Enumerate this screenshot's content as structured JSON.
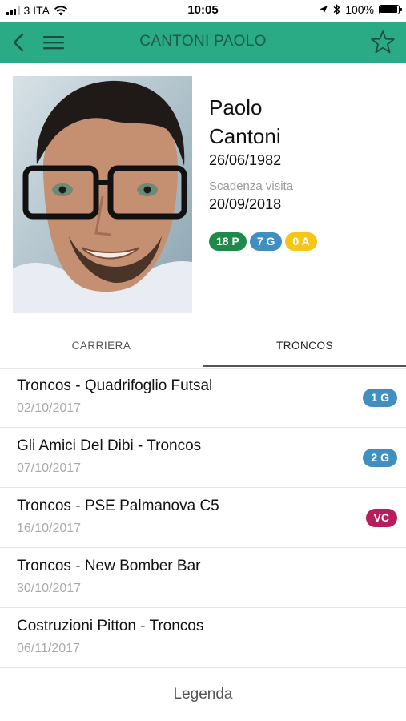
{
  "status_bar": {
    "carrier": "3 ITA",
    "time": "10:05",
    "battery": "100%",
    "battery_level": 1.0,
    "icons": [
      "signal-icon",
      "wifi-icon",
      "location-icon",
      "bluetooth-icon",
      "battery-icon"
    ]
  },
  "app_bar": {
    "title": "CANTONI PAOLO",
    "background_color": "#2aab86",
    "icons": [
      "back-icon",
      "menu-icon",
      "star-icon"
    ]
  },
  "profile": {
    "first_name": "Paolo",
    "last_name": "Cantoni",
    "birth_date": "26/06/1982",
    "visit_label": "Scadenza visita",
    "visit_date": "20/09/2018",
    "badges": [
      {
        "label": "18 P",
        "color": "#1e8a4a"
      },
      {
        "label": "7 G",
        "color": "#3f8fc0"
      },
      {
        "label": "0 A",
        "color": "#f5c518"
      }
    ]
  },
  "tabs": [
    {
      "label": "CARRIERA",
      "active": false
    },
    {
      "label": "TRONCOS",
      "active": true
    }
  ],
  "matches": [
    {
      "teams": "Troncos - Quadrifoglio Futsal",
      "date": "02/10/2017",
      "tag": "1 G",
      "tag_color": "#3f8fc0"
    },
    {
      "teams": "Gli Amici Del Dibi - Troncos",
      "date": "07/10/2017",
      "tag": "2 G",
      "tag_color": "#3f8fc0"
    },
    {
      "teams": "Troncos - PSE Palmanova C5",
      "date": "16/10/2017",
      "tag": "VC",
      "tag_color": "#b81e5c"
    },
    {
      "teams": "Troncos - New Bomber Bar",
      "date": "30/10/2017",
      "tag": "",
      "tag_color": ""
    },
    {
      "teams": "Costruzioni Pitton - Troncos",
      "date": "06/11/2017",
      "tag": "",
      "tag_color": ""
    }
  ],
  "legend_label": "Legenda"
}
